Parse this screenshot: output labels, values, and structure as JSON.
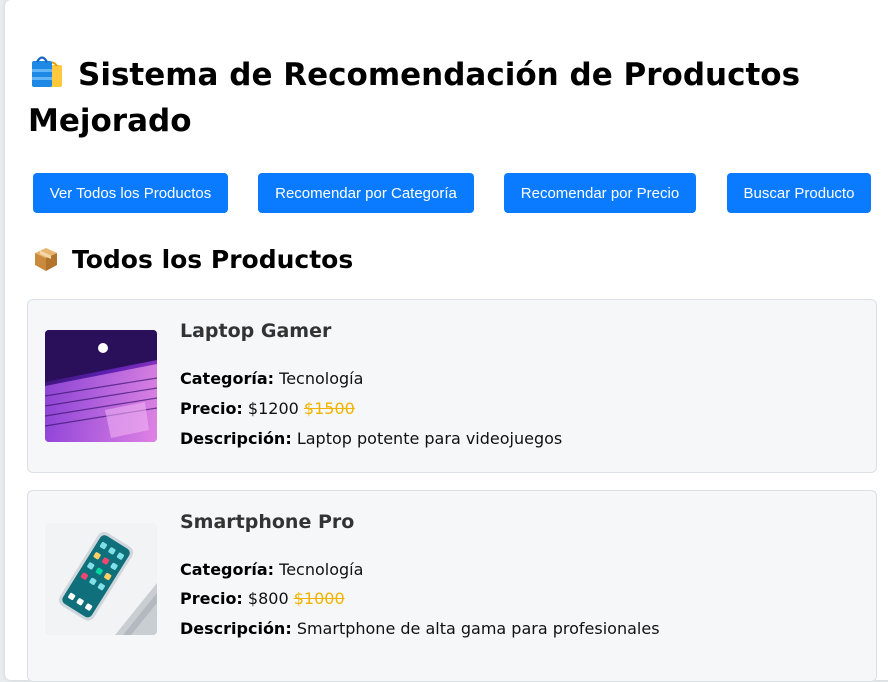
{
  "header": {
    "icon": "shopping-bags-icon",
    "title": "Sistema de Recomendación de Productos Mejorado"
  },
  "toolbar": {
    "buttons": [
      {
        "label": "Ver Todos los Productos"
      },
      {
        "label": "Recomendar por Categoría"
      },
      {
        "label": "Recomendar por Precio"
      },
      {
        "label": "Buscar Producto"
      }
    ]
  },
  "section": {
    "icon": "package-icon",
    "title": "Todos los Productos"
  },
  "labels": {
    "category": "Categoría:",
    "price": "Precio:",
    "description": "Descripción:"
  },
  "products": [
    {
      "name": "Laptop Gamer",
      "category": "Tecnología",
      "price": "$1200",
      "old_price": "$1500",
      "description": "Laptop potente para videojuegos",
      "image": "laptop-photo"
    },
    {
      "name": "Smartphone Pro",
      "category": "Tecnología",
      "price": "$800",
      "old_price": "$1000",
      "description": "Smartphone de alta gama para profesionales",
      "image": "smartphone-photo"
    }
  ],
  "colors": {
    "button": "#0a7bff",
    "old_price": "#f0b400",
    "card_bg": "#f6f7f9"
  }
}
